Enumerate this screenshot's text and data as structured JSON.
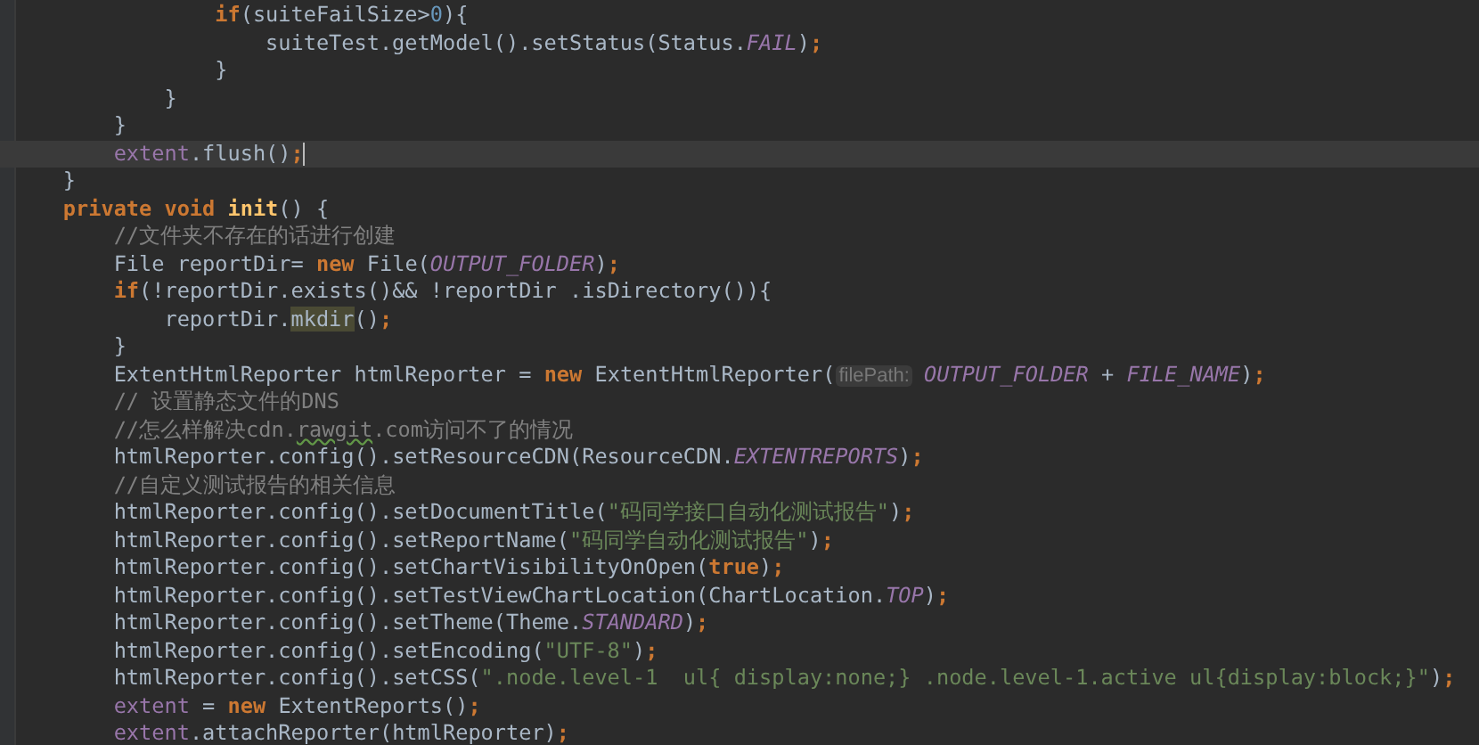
{
  "editor": {
    "lines": [
      {
        "children": [
          {
            "children": [
              {
                "children": [
                  {
                    "current": false,
                    "tokens": [
                      {
                        "kind": "kw",
                        "text": "if"
                      },
                      {
                        "kind": "p",
                        "text": "(suiteFailSize>"
                      },
                      {
                        "kind": "num",
                        "text": "0"
                      },
                      {
                        "kind": "p",
                        "text": "){"
                      }
                    ]
                  },
                  {
                    "children": [
                      {
                        "current": false,
                        "tokens": [
                          {
                            "kind": "p",
                            "text": "suiteTest.getModel().setStatus(Status."
                          },
                          {
                            "kind": "const",
                            "text": "FAIL"
                          },
                          {
                            "kind": "p",
                            "text": ")"
                          },
                          {
                            "kind": "kw",
                            "text": ";"
                          }
                        ]
                      }
                    ]
                  },
                  {
                    "current": false,
                    "tokens": [
                      {
                        "kind": "p",
                        "text": "}"
                      }
                    ]
                  }
                ]
              },
              {
                "current": false,
                "tokens": [
                  {
                    "kind": "p",
                    "text": "}"
                  }
                ]
              }
            ]
          },
          {
            "current": false,
            "tokens": [
              {
                "kind": "p",
                "text": "}"
              }
            ]
          },
          {
            "current": true,
            "tokens": [
              {
                "kind": "field",
                "text": "extent"
              },
              {
                "kind": "p",
                "text": ".flush()"
              },
              {
                "kind": "kw",
                "text": ";"
              }
            ]
          }
        ]
      },
      {
        "current": false,
        "tokens": [
          {
            "kind": "p",
            "text": "}"
          }
        ]
      },
      {
        "current": false,
        "tokens": [
          {
            "kind": "kw",
            "text": "private void"
          },
          {
            "kind": "decl",
            "text": "init"
          },
          {
            "kind": "p",
            "text": "() {"
          }
        ]
      },
      {
        "children": [
          {
            "current": false,
            "tokens": [
              {
                "kind": "comment",
                "text": "//文件夹不存在的话进行创建"
              }
            ]
          },
          {
            "current": false,
            "tokens": [
              {
                "kind": "p",
                "text": "File reportDir="
              },
              {
                "kind": "kw",
                "text": "new"
              },
              {
                "kind": "p",
                "text": "File("
              },
              {
                "kind": "const",
                "text": "OUTPUT_FOLDER"
              },
              {
                "kind": "p",
                "text": ")"
              },
              {
                "kind": "kw",
                "text": ";"
              }
            ]
          },
          {
            "current": false,
            "tokens": [
              {
                "kind": "kw",
                "text": "if"
              },
              {
                "kind": "p",
                "text": "(!reportDir.exists()&& !reportDir .isDirectory()){"
              }
            ]
          },
          {
            "children": [
              {
                "current": false,
                "tokens": [
                  {
                    "kind": "p",
                    "text": "reportDir."
                  },
                  {
                    "kind": "mark",
                    "text": "mkdir"
                  },
                  {
                    "kind": "p",
                    "text": "()"
                  },
                  {
                    "kind": "kw",
                    "text": ";"
                  }
                ]
              }
            ]
          },
          {
            "current": false,
            "tokens": [
              {
                "kind": "p",
                "text": "}"
              }
            ]
          },
          {
            "current": false,
            "tokens": [
              {
                "kind": "p",
                "text": "ExtentHtmlReporter htmlReporter ="
              },
              {
                "kind": "kw",
                "text": "new"
              },
              {
                "kind": "p",
                "text": "ExtentHtmlReporter("
              },
              {
                "kind": "hint",
                "text": "filePath:"
              },
              {
                "kind": "const",
                "text": "OUTPUT_FOLDER"
              },
              {
                "kind": "p",
                "text": "+"
              },
              {
                "kind": "const",
                "text": "FILE_NAME"
              },
              {
                "kind": "p",
                "text": ")"
              },
              {
                "kind": "kw",
                "text": ";"
              }
            ]
          },
          {
            "current": false,
            "tokens": [
              {
                "kind": "comment",
                "text": "// 设置静态文件的DNS"
              }
            ]
          },
          {
            "current": false,
            "tokens": [
              {
                "kind": "comment",
                "text": "//怎么样解决cdn."
              },
              {
                "kind": "typo",
                "text": "rawgit"
              },
              {
                "kind": "comment",
                "text": ".com访问不了的情况"
              }
            ]
          },
          {
            "current": false,
            "tokens": [
              {
                "kind": "p",
                "text": "htmlReporter.config().setResourceCDN(ResourceCDN."
              },
              {
                "kind": "const",
                "text": "EXTENTREPORTS"
              },
              {
                "kind": "p",
                "text": ")"
              },
              {
                "kind": "kw",
                "text": ";"
              }
            ]
          },
          {
            "current": false,
            "tokens": [
              {
                "kind": "comment",
                "text": "//自定义测试报告的相关信息"
              }
            ]
          },
          {
            "current": false,
            "tokens": [
              {
                "kind": "p",
                "text": "htmlReporter.config().setDocumentTitle("
              },
              {
                "kind": "str",
                "text": "\"码同学接口自动化测试报告\""
              },
              {
                "kind": "p",
                "text": ")"
              },
              {
                "kind": "kw",
                "text": ";"
              }
            ]
          },
          {
            "current": false,
            "tokens": [
              {
                "kind": "p",
                "text": "htmlReporter.config().setReportName("
              },
              {
                "kind": "str",
                "text": "\"码同学自动化测试报告\""
              },
              {
                "kind": "p",
                "text": ")"
              },
              {
                "kind": "kw",
                "text": ";"
              }
            ]
          },
          {
            "current": false,
            "tokens": [
              {
                "kind": "p",
                "text": "htmlReporter.config().setChartVisibilityOnOpen("
              },
              {
                "kind": "kw",
                "text": "true"
              },
              {
                "kind": "p",
                "text": ")"
              },
              {
                "kind": "kw",
                "text": ";"
              }
            ]
          },
          {
            "current": false,
            "tokens": [
              {
                "kind": "p",
                "text": "htmlReporter.config().setTestViewChartLocation(ChartLocation."
              },
              {
                "kind": "const",
                "text": "TOP"
              },
              {
                "kind": "p",
                "text": ")"
              },
              {
                "kind": "kw",
                "text": ";"
              }
            ]
          },
          {
            "current": false,
            "tokens": [
              {
                "kind": "p",
                "text": "htmlReporter.config().setTheme(Theme."
              },
              {
                "kind": "const",
                "text": "STANDARD"
              },
              {
                "kind": "p",
                "text": ")"
              },
              {
                "kind": "kw",
                "text": ";"
              }
            ]
          },
          {
            "current": false,
            "tokens": [
              {
                "kind": "p",
                "text": "htmlReporter.config().setEncoding("
              },
              {
                "kind": "str",
                "text": "\"UTF-8\""
              },
              {
                "kind": "p",
                "text": ")"
              },
              {
                "kind": "kw",
                "text": ";"
              }
            ]
          },
          {
            "current": false,
            "tokens": [
              {
                "kind": "p",
                "text": "htmlReporter.config().setCSS("
              },
              {
                "kind": "str",
                "text": "\".node.level-1  ul{ display:none;} .node.level-1.active ul{display:block;}\""
              },
              {
                "kind": "p",
                "text": ")"
              },
              {
                "kind": "kw",
                "text": ";"
              }
            ]
          },
          {
            "current": false,
            "tokens": [
              {
                "kind": "field",
                "text": "extent"
              },
              {
                "kind": "p",
                "text": "="
              },
              {
                "kind": "kw",
                "text": "new"
              },
              {
                "kind": "p",
                "text": "ExtentReports()"
              },
              {
                "kind": "kw",
                "text": ";"
              }
            ]
          },
          {
            "current": false,
            "tokens": [
              {
                "kind": "field",
                "text": "extent"
              },
              {
                "kind": "p",
                "text": ".attachReporter(htmlReporter)"
              },
              {
                "kind": "kw",
                "text": ";"
              }
            ]
          }
        ]
      }
    ]
  }
}
